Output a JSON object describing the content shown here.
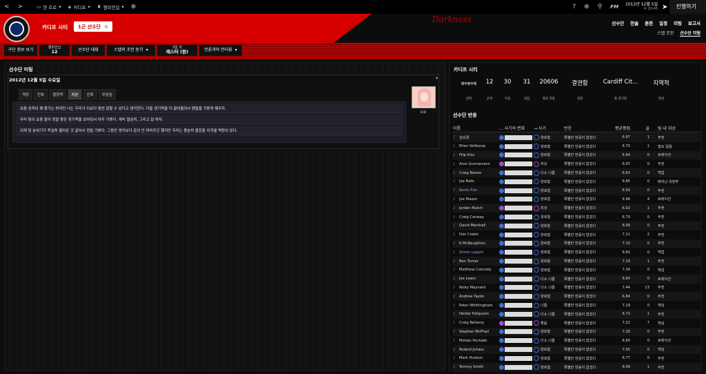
{
  "topbar": {
    "back": "<",
    "forward": ">",
    "home_label": "현 호로",
    "club_label": "카디프",
    "comp_label": "챔피언십",
    "date": "1012년 12월 5일",
    "time": "수 20:45",
    "advance": "진행하기",
    "fm_label": "FM"
  },
  "header": {
    "club": "카디프 시티",
    "team": "1군 선수단",
    "signature": "Darkness",
    "main_nav": [
      "선수단",
      "전술",
      "훈련",
      "일정",
      "미팅",
      "보고서"
    ],
    "sub_nav": [
      "스탭 조언",
      "선수단 미팅"
    ]
  },
  "tabs": [
    {
      "label": "구단 정보 보기"
    },
    {
      "top": "챔피언십",
      "label": "12"
    },
    {
      "label": "선수단 대화"
    },
    {
      "label": "스탭의 조언 듣기"
    },
    {
      "top": "3일 뒤",
      "label": "레스터 (원)"
    },
    {
      "label": "언론과의 인터뷰"
    }
  ],
  "left": {
    "title": "선수단 미팅",
    "date_label": "2012년 12월 5일 수요일",
    "tones": [
      "격앙",
      "단호",
      "열정적",
      "차분",
      "신뢰",
      "무임임"
    ],
    "statements": [
      "요즘 성적이 꽤 좋기는 하지만 나는 우리가 이보다 훨씬 잘할 수 있다고 생각한다. 다들 경기력을 더 끌어올려서 팬들을 기쁘게 해주자.",
      "우리 팀이 요즘 들어 정말 좋은 경기력을 보여줘서 아주 기쁘다. 계속 열심히, 그리고 잘 하자.",
      "이제 팀 분위기가 착실히 올라온 것 같아서 정말 기쁘다. 그동안 생각보다 운이 안 따라주긴 했지만 우리는 충분히 불운을 이겨낼 역량이 있다."
    ],
    "portrait_label": "오로"
  },
  "right": {
    "club_title": "카디프 시티",
    "stats": [
      {
        "v": "",
        "l": "성적"
      },
      {
        "v": "12",
        "l": "순위"
      },
      {
        "v": "30",
        "l": "득점"
      },
      {
        "v": "31",
        "l": "실점"
      },
      {
        "v": "20606",
        "l": "평균 관중"
      },
      {
        "v": "결연함",
        "l": "성향"
      },
      {
        "v": "Cardiff Cit...",
        "l": "홈 경기장"
      },
      {
        "v": "지역적",
        "l": "명성"
      }
    ],
    "form_label": "패무패무패",
    "reactions_title": "선수단 반응",
    "headers": {
      "name": "이름",
      "change": "... 사기의 변화",
      "morale": "→ 사기",
      "reaction": "반응",
      "avg": "평균평점",
      "goals": "골",
      "pos": "팀 내 위상"
    },
    "players": [
      {
        "n": "김보경",
        "m": "양호함",
        "r": "특별한 반응이 없었다",
        "a": "6.97",
        "g": "1",
        "p": "주전",
        "c": "#3a6fd8",
        "mp": false
      },
      {
        "n": "Etien Velikonja",
        "m": "양호함",
        "r": "특별한 반응이 없었다",
        "a": "6.70",
        "g": "1",
        "p": "필요 없음",
        "c": "#3a6fd8",
        "mp": false
      },
      {
        "n": "Filip Kiss",
        "m": "양호함",
        "r": "특별한 반응이 없었다",
        "a": "6.69",
        "g": "0",
        "p": "로테이션",
        "c": "#3a6fd8",
        "mp": false
      },
      {
        "n": "Aron Gunnarsson",
        "m": "최상",
        "r": "특별한 반응이 없었다",
        "a": "6.97",
        "g": "0",
        "p": "주전",
        "c": "#9a4fd0",
        "mp": true
      },
      {
        "n": "Craig Noone",
        "m": "다소 나쁨",
        "r": "특별한 반응이 없었다",
        "a": "6.63",
        "g": "0",
        "p": "백업",
        "c": "#3a6fd8",
        "mp": false
      },
      {
        "n": "Joe Ralls",
        "m": "양호함",
        "r": "특별한 반응이 없었다",
        "a": "6.85",
        "g": "0",
        "p": "뛰어난 유망주",
        "c": "#3a6fd8",
        "mp": false
      },
      {
        "n": "Kerim Frei",
        "m": "양호함",
        "r": "특별한 반응이 없었다",
        "a": "6.50",
        "g": "0",
        "p": "주전",
        "c": "#3a6fd8",
        "mp": false
      },
      {
        "n": "Joe Mason",
        "m": "양호함",
        "r": "특별한 반응이 없었다",
        "a": "6.96",
        "g": "4",
        "p": "로테이션",
        "c": "#3a6fd8",
        "mp": false
      },
      {
        "n": "Jordon Mutch",
        "m": "최상",
        "r": "특별한 반응이 없었다",
        "a": "6.92",
        "g": "1",
        "p": "주전",
        "c": "#9a4fd0",
        "mp": true
      },
      {
        "n": "Craig Conway",
        "m": "양호함",
        "r": "특별한 반응이 없었다",
        "a": "6.70",
        "g": "0",
        "p": "주전",
        "c": "#3a6fd8",
        "mp": false
      },
      {
        "n": "David Marshall",
        "m": "양호함",
        "r": "특별한 반응이 없었다",
        "a": "6.99",
        "g": "0",
        "p": "주전",
        "c": "#3a6fd8",
        "mp": false
      },
      {
        "n": "Don Cowie",
        "m": "양호함",
        "r": "특별한 반응이 없었다",
        "a": "7.11",
        "g": "2",
        "p": "주전",
        "c": "#3a6fd8",
        "mp": false
      },
      {
        "n": "K McNaughton",
        "m": "양호함",
        "r": "특별한 반응이 없었다",
        "a": "7.10",
        "g": "0",
        "p": "주전",
        "c": "#3a6fd8",
        "mp": false
      },
      {
        "n": "Simon Lappin",
        "m": "양호함",
        "r": "특별한 반응이 없었다",
        "a": "6.82",
        "g": "0",
        "p": "백업",
        "c": "#3a6fd8",
        "mp": false
      },
      {
        "n": "Ben Turner",
        "m": "양호함",
        "r": "특별한 반응이 없었다",
        "a": "7.19",
        "g": "1",
        "p": "주전",
        "c": "#3a6fd8",
        "mp": false
      },
      {
        "n": "Matthew Connolly",
        "m": "양호함",
        "r": "특별한 반응이 없었다",
        "a": "7.34",
        "g": "0",
        "p": "핵심",
        "c": "#3a6fd8",
        "mp": false
      },
      {
        "n": "Joe Lewis",
        "m": "다소 나쁨",
        "r": "특별한 반응이 없었다",
        "a": "6.60",
        "g": "0",
        "p": "로테이션",
        "c": "#3a6fd8",
        "mp": false
      },
      {
        "n": "Nicky Maynard",
        "m": "다소 나쁨",
        "r": "특별한 반응이 없었다",
        "a": "7.44",
        "g": "13",
        "p": "주전",
        "c": "#3a6fd8",
        "mp": false
      },
      {
        "n": "Andrew Taylor",
        "m": "양호함",
        "r": "특별한 반응이 없었다",
        "a": "6.84",
        "g": "0",
        "p": "주전",
        "c": "#3a6fd8",
        "mp": false
      },
      {
        "n": "Peter Whittingham",
        "m": "나쁨",
        "r": "특별한 반응이 없었다",
        "a": "7.19",
        "g": "0",
        "p": "핵심",
        "c": "#3a6fd8",
        "mp": false
      },
      {
        "n": "Heidar Helguson",
        "m": "다소 나쁨",
        "r": "특별한 반응이 없었다",
        "a": "6.72",
        "g": "1",
        "p": "주전",
        "c": "#3a6fd8",
        "mp": false
      },
      {
        "n": "Craig Bellamy",
        "m": "좋음",
        "r": "특별한 반응이 없었다",
        "a": "7.22",
        "g": "7",
        "p": "핵심",
        "c": "#9a4fd0",
        "mp": true
      },
      {
        "n": "Stephen McPhail",
        "m": "양호함",
        "r": "특별한 반응이 없었다",
        "a": "7.26",
        "g": "0",
        "p": "주전",
        "c": "#3a6fd8",
        "mp": false
      },
      {
        "n": "Moisés Hurtado",
        "m": "다소 나쁨",
        "r": "특별한 반응이 없었다",
        "a": "6.80",
        "g": "0",
        "p": "로테이션",
        "c": "#3a6fd8",
        "mp": false
      },
      {
        "n": "Roland Juhász",
        "m": "양호함",
        "r": "특별한 반응이 없었다",
        "a": "7.55",
        "g": "0",
        "p": "핵심",
        "c": "#3a6fd8",
        "mp": false
      },
      {
        "n": "Mark Hudson",
        "m": "양호함",
        "r": "특별한 반응이 없었다",
        "a": "6.77",
        "g": "0",
        "p": "주전",
        "c": "#3a6fd8",
        "mp": false
      },
      {
        "n": "Tommy Smith",
        "m": "양호함",
        "r": "특별한 반응이 없었다",
        "a": "6.49",
        "g": "1",
        "p": "주전",
        "c": "#3a6fd8",
        "mp": false
      }
    ]
  }
}
